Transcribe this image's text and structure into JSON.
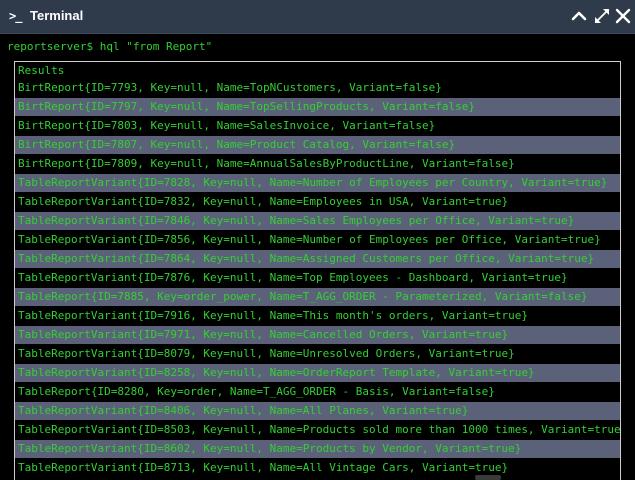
{
  "window": {
    "title": "Terminal",
    "title_icon": "terminal-prompt-icon",
    "prompt_glyph": ">_",
    "buttons": {
      "collapse_icon": "chevron-up-icon",
      "expand_icon": "expand-arrows-icon",
      "close_icon": "close-icon"
    }
  },
  "colors": {
    "titlebar": "#2f3a4a",
    "terminal_bg": "#000000",
    "text_green": "#33d033",
    "stripe": "#5c617a",
    "box_border": "#cfcfcf"
  },
  "terminal": {
    "prompt": "reportserver$ hql \"from Report\"",
    "results_header": "Results",
    "rows": [
      "BirtReport{ID=7793, Key=null, Name=TopNCustomers, Variant=false}",
      "BirtReport{ID=7797, Key=null, Name=TopSellingProducts, Variant=false}",
      "BirtReport{ID=7803, Key=null, Name=SalesInvoice, Variant=false}",
      "BirtReport{ID=7807, Key=null, Name=Product Catalog, Variant=false}",
      "BirtReport{ID=7809, Key=null, Name=AnnualSalesByProductLine, Variant=false}",
      "TableReportVariant{ID=7828, Key=null, Name=Number of Employees per Country, Variant=true}",
      "TableReportVariant{ID=7832, Key=null, Name=Employees in USA, Variant=true}",
      "TableReportVariant{ID=7846, Key=null, Name=Sales Employees per Office, Variant=true}",
      "TableReportVariant{ID=7856, Key=null, Name=Number of Employees per Office, Variant=true}",
      "TableReportVariant{ID=7864, Key=null, Name=Assigned Customers per Office, Variant=true}",
      "TableReportVariant{ID=7876, Key=null, Name=Top Employees - Dashboard, Variant=true}",
      "TableReport{ID=7885, Key=order_power, Name=T_AGG_ORDER - Parameterized, Variant=false}",
      "TableReportVariant{ID=7916, Key=null, Name=This month's orders, Variant=true}",
      "TableReportVariant{ID=7971, Key=null, Name=Cancelled Orders, Variant=true}",
      "TableReportVariant{ID=8079, Key=null, Name=Unresolved Orders, Variant=true}",
      "TableReportVariant{ID=8258, Key=null, Name=OrderReport Template, Variant=true}",
      "TableReport{ID=8280, Key=order, Name=T_AGG_ORDER - Basis, Variant=false}",
      "TableReportVariant{ID=8406, Key=null, Name=All Planes, Variant=true}",
      "TableReportVariant{ID=8503, Key=null, Name=Products sold more than 1000 times, Variant=true}",
      "TableReportVariant{ID=8602, Key=null, Name=Products by Vendor, Variant=true}",
      "TableReportVariant{ID=8713, Key=null, Name=All Vintage Cars, Variant=true}"
    ]
  }
}
